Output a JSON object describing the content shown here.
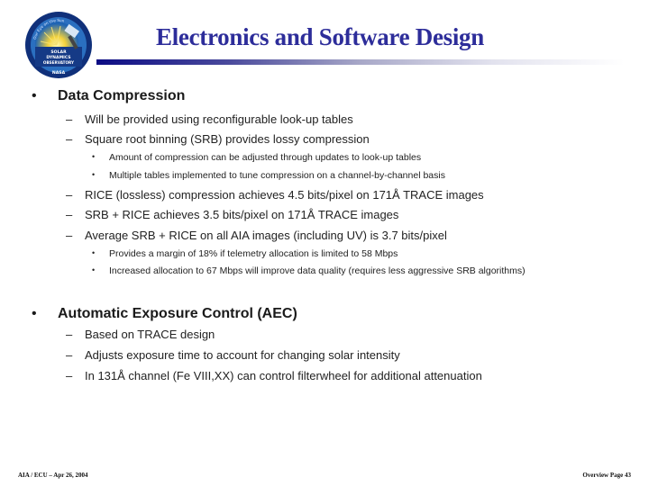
{
  "header": {
    "title": "Electronics and Software Design",
    "logo": {
      "name": "solar-dynamics-observatory-logo",
      "ring_text": "Our Eye on the Sun",
      "center_text": [
        "SOLAR",
        "DYNAMICS",
        "OBSERVATORY"
      ],
      "bottom_text": "NASA"
    }
  },
  "sections": [
    {
      "bullet": "•",
      "label": "Data Compression",
      "items": [
        {
          "bullet": "–",
          "text": "Will be provided using reconfigurable look-up tables",
          "subitems": []
        },
        {
          "bullet": "–",
          "text": "Square root binning (SRB) provides lossy compression",
          "subitems": [
            {
              "bullet": "•",
              "text": "Amount of compression can be adjusted through updates to look-up tables"
            },
            {
              "bullet": "•",
              "text": "Multiple tables implemented to tune compression on a channel-by-channel basis"
            }
          ]
        },
        {
          "bullet": "–",
          "text": "RICE (lossless) compression achieves 4.5 bits/pixel on 171Å TRACE images",
          "subitems": []
        },
        {
          "bullet": "–",
          "text": "SRB + RICE achieves 3.5 bits/pixel on 171Å TRACE images",
          "subitems": []
        },
        {
          "bullet": "–",
          "text": "Average SRB + RICE on all AIA images (including UV) is 3.7 bits/pixel",
          "subitems": [
            {
              "bullet": "•",
              "text": "Provides a margin of 18% if telemetry allocation is limited to 58 Mbps"
            },
            {
              "bullet": "•",
              "text": "Increased allocation to 67 Mbps will improve data quality (requires less aggressive SRB algorithms)"
            }
          ]
        }
      ]
    },
    {
      "bullet": "•",
      "label": "Automatic Exposure Control (AEC)",
      "items": [
        {
          "bullet": "–",
          "text": "Based on TRACE design",
          "subitems": []
        },
        {
          "bullet": "–",
          "text": "Adjusts exposure time to account for changing solar intensity",
          "subitems": []
        },
        {
          "bullet": "–",
          "text": "In 131Å channel (Fe VIII,XX) can control filterwheel for additional attenuation",
          "subitems": []
        }
      ]
    }
  ],
  "footer": {
    "left": "AIA / ECU – Apr 26, 2004",
    "right": "Overview Page 43"
  },
  "colors": {
    "title": "#2d2d9a",
    "bar_start": "#0c0c84",
    "bar_end": "#ffffff"
  }
}
